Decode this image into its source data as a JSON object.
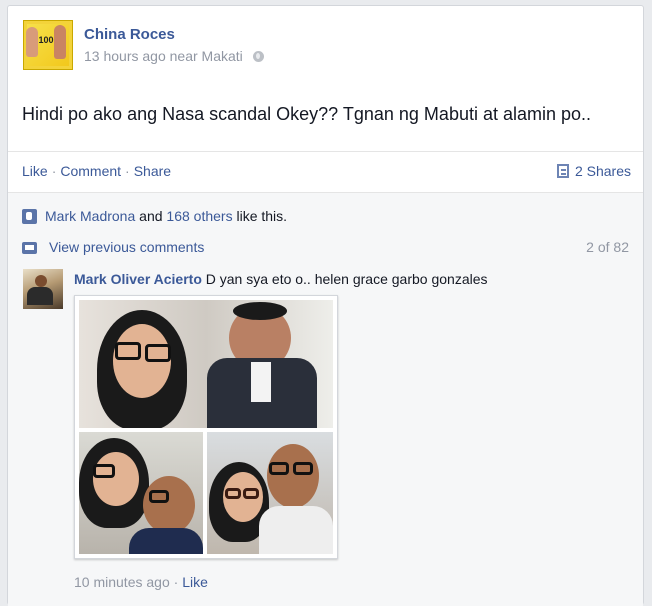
{
  "post": {
    "author": "China Roces",
    "avatar_badge": "100",
    "time": "13 hours ago",
    "location": "near Makati",
    "audience_icon": "globe-icon",
    "text": "Hindi po ako ang Nasa scandal Okey?? Tgnan ng Mabuti at alamin po.."
  },
  "actions": {
    "like": "Like",
    "comment": "Comment",
    "share": "Share",
    "dot": "·",
    "shares_count": "2 Shares"
  },
  "likes": {
    "first_liker": "Mark Madrona",
    "and": "and",
    "others": "168 others",
    "suffix": "like this."
  },
  "comments": {
    "view_previous": "View previous comments",
    "count": "2 of 82",
    "items": [
      {
        "author": "Mark Oliver Acierto",
        "text": "D yan sya eto o.. helen grace garbo gonzales",
        "time": "10 minutes ago",
        "like": "Like"
      }
    ]
  },
  "colors": {
    "link": "#3b5998",
    "muted": "#9197a3",
    "text": "#141823"
  }
}
